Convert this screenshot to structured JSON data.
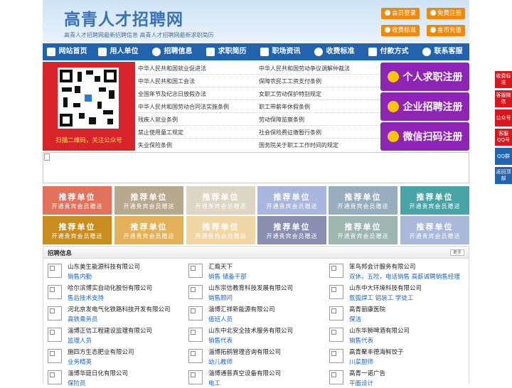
{
  "header": {
    "title": "高青人才招聘网",
    "subtitle": "高青人才招聘网最新招聘信息  高青人才招聘网最新求职简历",
    "buttons": [
      "会员登录",
      "免费注册",
      "收费标准",
      "金币充值"
    ]
  },
  "nav": [
    {
      "label": "网站首页",
      "icon": "home-icon"
    },
    {
      "label": "用人单位",
      "icon": "building-icon"
    },
    {
      "label": "招聘信息",
      "icon": "megaphone-icon"
    },
    {
      "label": "求职简历",
      "icon": "resume-icon"
    },
    {
      "label": "职场资讯",
      "icon": "news-icon"
    },
    {
      "label": "收费标准",
      "icon": "pricing-icon"
    },
    {
      "label": "付款方式",
      "icon": "payment-icon"
    },
    {
      "label": "联系客服",
      "icon": "phone-icon"
    }
  ],
  "qr_caption": "扫描二维码，关注公众号",
  "laws": {
    "left": [
      "中华人民共和国就业促进法",
      "中华人民共和国工会法",
      "全国年节及纪念日放假办法",
      "中华人民共和国劳动合同法实施条例",
      "残疾人就业条例",
      "禁止使用童工规定",
      "失业保险条例"
    ],
    "right": [
      "中华人民共和国劳动争议调解仲裁法",
      "保障农民工工资支付条例",
      "女职工劳动保护特别规定",
      "职工带薪年休假条例",
      "劳动保障监察条例",
      "社会保险费征缴暂行条例",
      "国务院关于职工工作时间的规定"
    ]
  },
  "register": [
    {
      "label": "个人求职注册",
      "icon": "person-icon"
    },
    {
      "label": "企业招聘注册",
      "icon": "company-icon"
    },
    {
      "label": "微信扫码注册",
      "icon": "wechat-icon"
    }
  ],
  "recommend": {
    "title": "推荐单位",
    "sub": "开通贵宾会员赠送",
    "colors": [
      "#e2725b",
      "#b7a98e",
      "#ddd6c4",
      "#a9b7de",
      "#97aebf",
      "#49a4a7",
      "#c98d1d",
      "#e2b15a",
      "#f1d7a6",
      "#8a8fb0",
      "#9db6b0",
      "#aab8da"
    ]
  },
  "jobs": {
    "title": "招聘信息",
    "more": "更多",
    "items": [
      {
        "company": "山东美生能源科技有限公司",
        "position": "销售内勤"
      },
      {
        "company": "汇裔天下",
        "position": "销售 储备干部"
      },
      {
        "company": "笨鸟邦会计服务有限公司",
        "position": "双休，五险，电话销售 高薪诚聘销售经理"
      },
      {
        "company": "哈尔滨博实自动化股份有限公司",
        "position": "售后技术支持"
      },
      {
        "company": "山东宗信教育科技发展有限公司",
        "position": "销售顾问"
      },
      {
        "company": "山东中大环境科技有限公司",
        "position": "氩弧焊工 铝装工 学徒工"
      },
      {
        "company": "河北京发电气化铁路科技开发有限公司",
        "position": "高铁乘务员"
      },
      {
        "company": "淄博汇祥新能源有限公司",
        "position": "值班人员"
      },
      {
        "company": "高青丽康医院",
        "position": "保洁"
      },
      {
        "company": "淄博正信工程建设监理有限公司",
        "position": "监理人员"
      },
      {
        "company": "山东中北安全技术服务有限公司",
        "position": "销售代表"
      },
      {
        "company": "山东华狮啤酒有限公司",
        "position": "销售代表"
      },
      {
        "company": "施四方生态肥业有限公司",
        "position": "业务精英"
      },
      {
        "company": "淄博拓鹞管理咨询有限公司",
        "position": "幼儿教师"
      },
      {
        "company": "高青聚丰德海鲜饺子",
        "position": "川菜厨师"
      },
      {
        "company": "淄博华庭日化有限公司",
        "position": "保险员"
      },
      {
        "company": "淄博通普真空设备有限公司",
        "position": "电工"
      },
      {
        "company": "高青一诺广告",
        "position": "平面设计"
      }
    ]
  },
  "side": [
    {
      "label": "收费标准",
      "color": "#d9161c"
    },
    {
      "label": "客服微信",
      "color": "#d9161c"
    },
    {
      "label": "公众号",
      "color": "#d9161c"
    },
    {
      "label": "客服QQ号",
      "color": "#d9161c"
    },
    {
      "label": "QQ群",
      "color": "#2263ad"
    },
    {
      "label": "返回顶部",
      "color": "#2263ad"
    }
  ],
  "colors": {
    "brand": "#2263ad",
    "accent": "#f0890a",
    "register": "#8e24b5",
    "qr_bg": "#d8232a",
    "link": "#1a66c2"
  }
}
